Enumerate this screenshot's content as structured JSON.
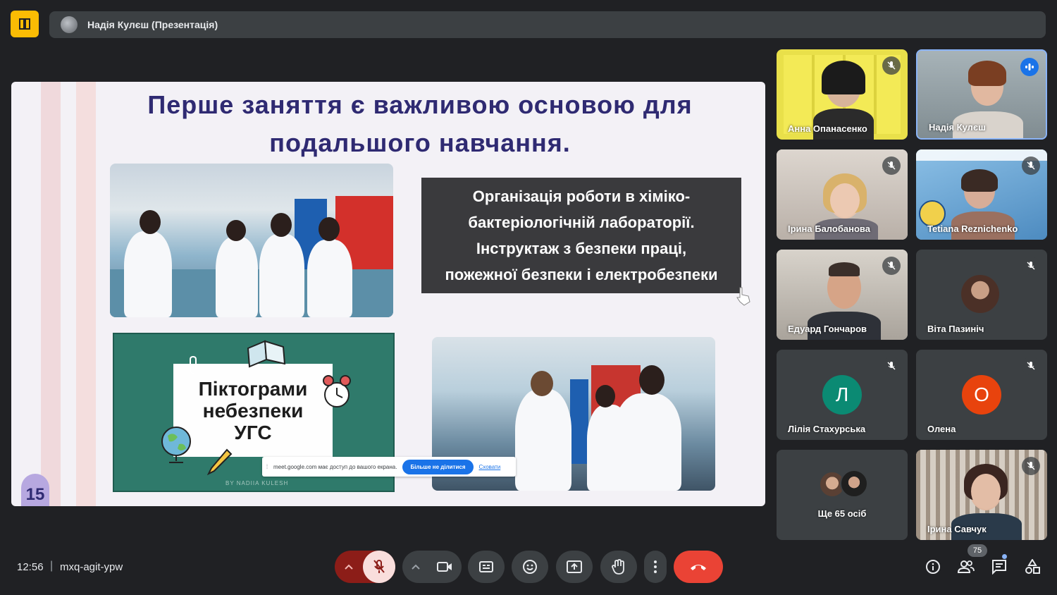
{
  "topbar": {
    "presenter_label": "Надія Кулєш (Презентація)"
  },
  "slide": {
    "title_line1": "Перше заняття  є важливою основою для",
    "title_line2": "подальшого навчання.",
    "textbox_lines": [
      "Організація роботи в хіміко-",
      "бактеріологічній лабораторії.",
      "Інструктаж з безпеки праці,",
      "пожежної безпеки і електробезпеки"
    ],
    "board_lines": [
      "Піктограми",
      "небезпеки",
      "УГС"
    ],
    "board_footer": "BY NADIIA KULESH",
    "slide_number": "15"
  },
  "share_notice": {
    "message": "meet.google.com має доступ до вашого екрана.",
    "stop_button": "Більше не ділитися",
    "hide_link": "Сховати"
  },
  "participants": [
    {
      "name": "Анна Опанасенко",
      "muted": true
    },
    {
      "name": "Надія Кулєш",
      "speaking": true
    },
    {
      "name": "Ірина Балобанова",
      "muted": true
    },
    {
      "name": "Tetiana Reznichenko",
      "muted": true
    },
    {
      "name": "Едуард Гончаров",
      "muted": true
    },
    {
      "name": "Віта Пазиніч",
      "muted": true
    },
    {
      "name": "Лілія Стахурська",
      "initial": "Л",
      "color": "#0b8a73",
      "muted": true
    },
    {
      "name": "Олена",
      "initial": "О",
      "color": "#e8430d",
      "muted": true
    },
    {
      "name": "Ще 65 осіб"
    },
    {
      "name": "Ірина Савчук",
      "muted": true
    }
  ],
  "bottom": {
    "time": "12:56",
    "separator": "|",
    "meeting_code": "mxq-agit-ypw",
    "people_count": "75"
  },
  "colors": {
    "background": "#202124",
    "end_call": "#ea4335",
    "accent_blue": "#1a73e8",
    "slide_title": "#2f2a72"
  }
}
